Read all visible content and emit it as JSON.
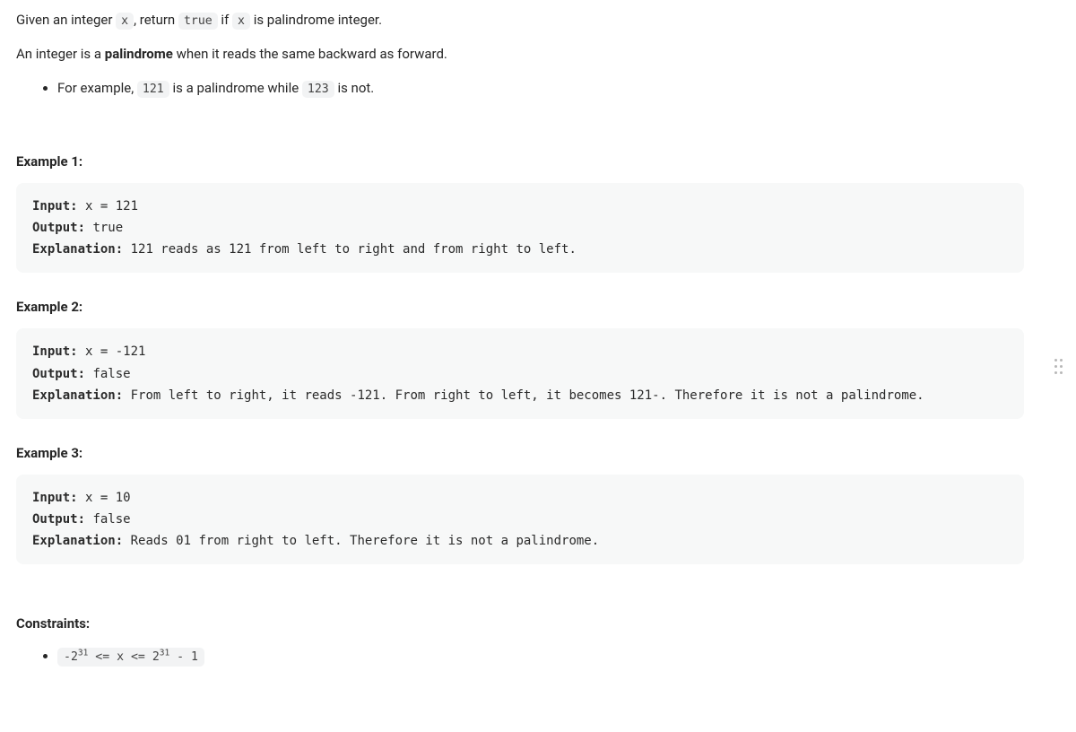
{
  "intro": {
    "para1_parts": [
      "Given an integer ",
      "x",
      ", return ",
      "true",
      " if ",
      "x",
      " is palindrome integer."
    ],
    "para2_parts": [
      "An integer is a ",
      "palindrome",
      " when it reads the same backward as forward."
    ],
    "bullet_parts": [
      "For example, ",
      "121",
      " is a palindrome while ",
      "123",
      " is not."
    ]
  },
  "examples": [
    {
      "heading": "Example 1:",
      "input_label": "Input:",
      "input_value": " x = 121",
      "output_label": "Output:",
      "output_value": " true",
      "explanation_label": "Explanation:",
      "explanation_value": " 121 reads as 121 from left to right and from right to left."
    },
    {
      "heading": "Example 2:",
      "input_label": "Input:",
      "input_value": " x = -121",
      "output_label": "Output:",
      "output_value": " false",
      "explanation_label": "Explanation:",
      "explanation_value": " From left to right, it reads -121. From right to left, it becomes 121-. Therefore it is not a palindrome."
    },
    {
      "heading": "Example 3:",
      "input_label": "Input:",
      "input_value": " x = 10",
      "output_label": "Output:",
      "output_value": " false",
      "explanation_label": "Explanation:",
      "explanation_value": " Reads 01 from right to left. Therefore it is not a palindrome."
    }
  ],
  "constraints": {
    "heading": "Constraints:",
    "item": {
      "neg_base": "-2",
      "neg_exp": "31",
      "mid": " <= x <= ",
      "pos_base": "2",
      "pos_exp": "31",
      "tail": " - 1"
    }
  }
}
